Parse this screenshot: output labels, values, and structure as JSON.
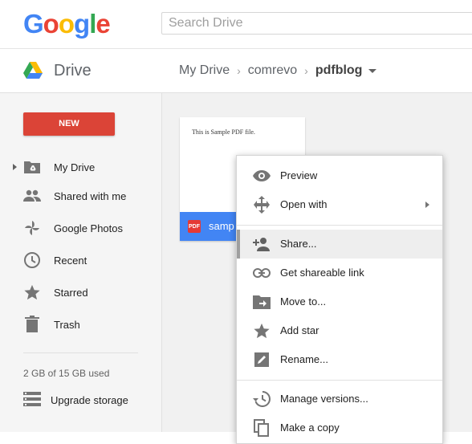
{
  "header": {
    "logo_letters": [
      {
        "ch": "G",
        "color": "#4285f4"
      },
      {
        "ch": "o",
        "color": "#ea4335"
      },
      {
        "ch": "o",
        "color": "#fbbc05"
      },
      {
        "ch": "g",
        "color": "#4285f4"
      },
      {
        "ch": "l",
        "color": "#34a853"
      },
      {
        "ch": "e",
        "color": "#ea4335"
      }
    ],
    "search_placeholder": "Search Drive"
  },
  "subheader": {
    "app_title": "Drive",
    "breadcrumb": [
      "My Drive",
      "comrevo",
      "pdfblog"
    ]
  },
  "sidebar": {
    "new_label": "NEW",
    "items": [
      {
        "label": "My Drive",
        "icon": "folder-drive-icon"
      },
      {
        "label": "Shared with me",
        "icon": "people-icon"
      },
      {
        "label": "Google Photos",
        "icon": "photos-pinwheel-icon"
      },
      {
        "label": "Recent",
        "icon": "clock-icon"
      },
      {
        "label": "Starred",
        "icon": "star-icon"
      },
      {
        "label": "Trash",
        "icon": "trash-icon"
      }
    ],
    "storage_text": "2 GB of 15 GB used",
    "upgrade_label": "Upgrade storage"
  },
  "file": {
    "preview_text": "This is Sample PDF file.",
    "badge": "PDF",
    "name": "samp"
  },
  "context_menu": {
    "items": [
      {
        "label": "Preview",
        "icon": "eye-icon"
      },
      {
        "label": "Open with",
        "icon": "move-arrows-icon",
        "submenu": true
      },
      {
        "label": "Share...",
        "icon": "add-person-icon",
        "active": true
      },
      {
        "label": "Get shareable link",
        "icon": "link-icon"
      },
      {
        "label": "Move to...",
        "icon": "move-to-folder-icon"
      },
      {
        "label": "Add star",
        "icon": "star-icon"
      },
      {
        "label": "Rename...",
        "icon": "pencil-icon"
      },
      {
        "label": "Manage versions...",
        "icon": "history-icon"
      },
      {
        "label": "Make a copy",
        "icon": "copy-icon"
      }
    ]
  },
  "colors": {
    "new_button": "#db4437",
    "file_label": "#4285f4",
    "pdf_badge": "#e53935"
  }
}
